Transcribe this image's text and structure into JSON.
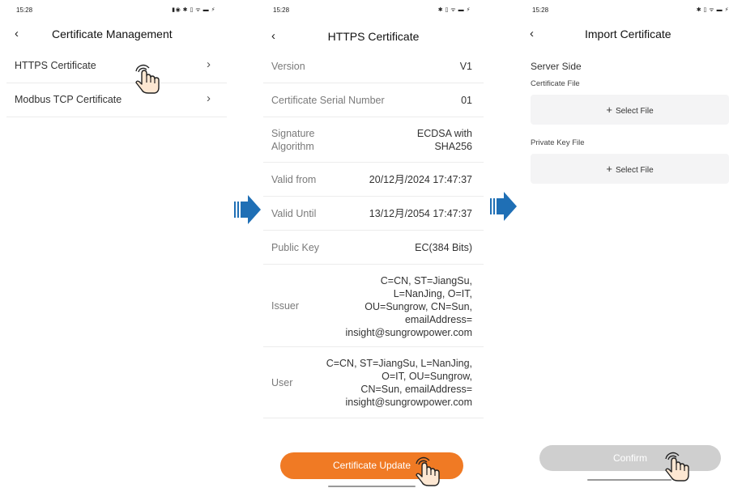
{
  "screens": {
    "cert_management": {
      "status_time": "15:28",
      "status_icons": "▮◉ ✱ ▯ ᯤ ▬ ⚡",
      "title": "Certificate Management",
      "items": [
        {
          "label": "HTTPS Certificate"
        },
        {
          "label": "Modbus TCP Certificate"
        }
      ]
    },
    "https_certificate": {
      "status_time": "15:28",
      "status_icons": "✱ ▯ ᯤ ▬ ⚡",
      "title": "HTTPS Certificate",
      "rows": [
        {
          "key": "Version",
          "value": "V1"
        },
        {
          "key": "Certificate Serial Number",
          "value": "01"
        },
        {
          "key": "Signature Algorithm",
          "value": "ECDSA with SHA256"
        },
        {
          "key": "Valid from",
          "value": "20/12月/2024 17:47:37"
        },
        {
          "key": "Valid Until",
          "value": "13/12月/2054 17:47:37"
        },
        {
          "key": "Public Key",
          "value": "EC(384 Bits)"
        },
        {
          "key": "Issuer",
          "value": "C=CN, ST=JiangSu,\nL=NanJing, O=IT,\nOU=Sungrow, CN=Sun,\nemailAddress=\ninsight@sungrowpower.com"
        },
        {
          "key": "User",
          "value": "C=CN, ST=JiangSu, L=NanJing,\nO=IT, OU=Sungrow,\nCN=Sun, emailAddress=\ninsight@sungrowpower.com"
        }
      ],
      "update_button": "Certificate Update"
    },
    "import_certificate": {
      "status_time": "15:28",
      "status_icons": "✱ ▯ ᯤ ▬ ⚡",
      "title": "Import Certificate",
      "section": "Server Side",
      "cert_file_label": "Certificate File",
      "cert_file_button": "Select File",
      "key_file_label": "Private Key File",
      "key_file_button": "Select File",
      "confirm_button": "Confirm"
    }
  },
  "colors": {
    "accent_orange": "#f07a24",
    "arrow_blue": "#1f6fb5",
    "disabled_grey": "#cfcfcf",
    "field_bg": "#f4f4f5"
  },
  "icons": [
    "back-icon",
    "chevron-right-icon",
    "plus-icon",
    "tap-hand-icon",
    "flow-arrow-icon"
  ]
}
